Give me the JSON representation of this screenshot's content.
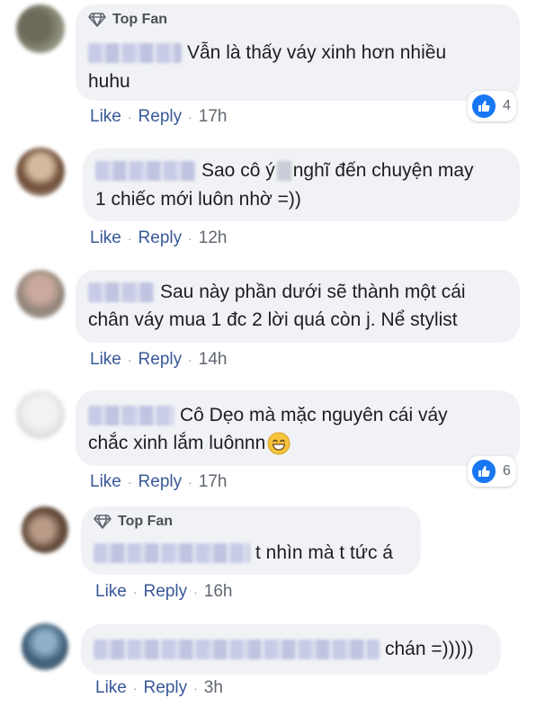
{
  "comments": [
    {
      "badge": "Top Fan",
      "lines": [
        "Vẫn là thấy váy xinh hơn nhiều",
        "huhu"
      ],
      "like": "Like",
      "reply": "Reply",
      "time": "17h",
      "reactions": "4"
    },
    {
      "lines_a": "Sao cô ý",
      "lines_b": "nghĩ đến chuyện may",
      "line2": "1 chiếc mới luôn nhờ =))",
      "like": "Like",
      "reply": "Reply",
      "time": "12h"
    },
    {
      "lines": [
        "Sau này phần dưới sẽ thành một cái",
        "chân váy mua 1 đc 2 lời quá còn j. Nể stylist"
      ],
      "like": "Like",
      "reply": "Reply",
      "time": "14h"
    },
    {
      "lines": [
        "Cô Dẹo mà mặc nguyên cái váy",
        "chắc xinh lắm luônnn"
      ],
      "emoji": "grinning-face-emoji",
      "like": "Like",
      "reply": "Reply",
      "time": "17h",
      "reactions": "6"
    },
    {
      "badge": "Top Fan",
      "lines": [
        "t nhìn mà t tức á"
      ],
      "like": "Like",
      "reply": "Reply",
      "time": "16h"
    },
    {
      "lines": [
        "chán =)))))"
      ],
      "like": "Like",
      "reply": "Reply",
      "time": "3h"
    }
  ],
  "colors": {
    "bubble": "#f0f2f5",
    "link": "#385898",
    "like_blue": "#1877f2",
    "text": "#1c1e21"
  },
  "icons": [
    "diamond-icon",
    "like-reaction-icon"
  ]
}
